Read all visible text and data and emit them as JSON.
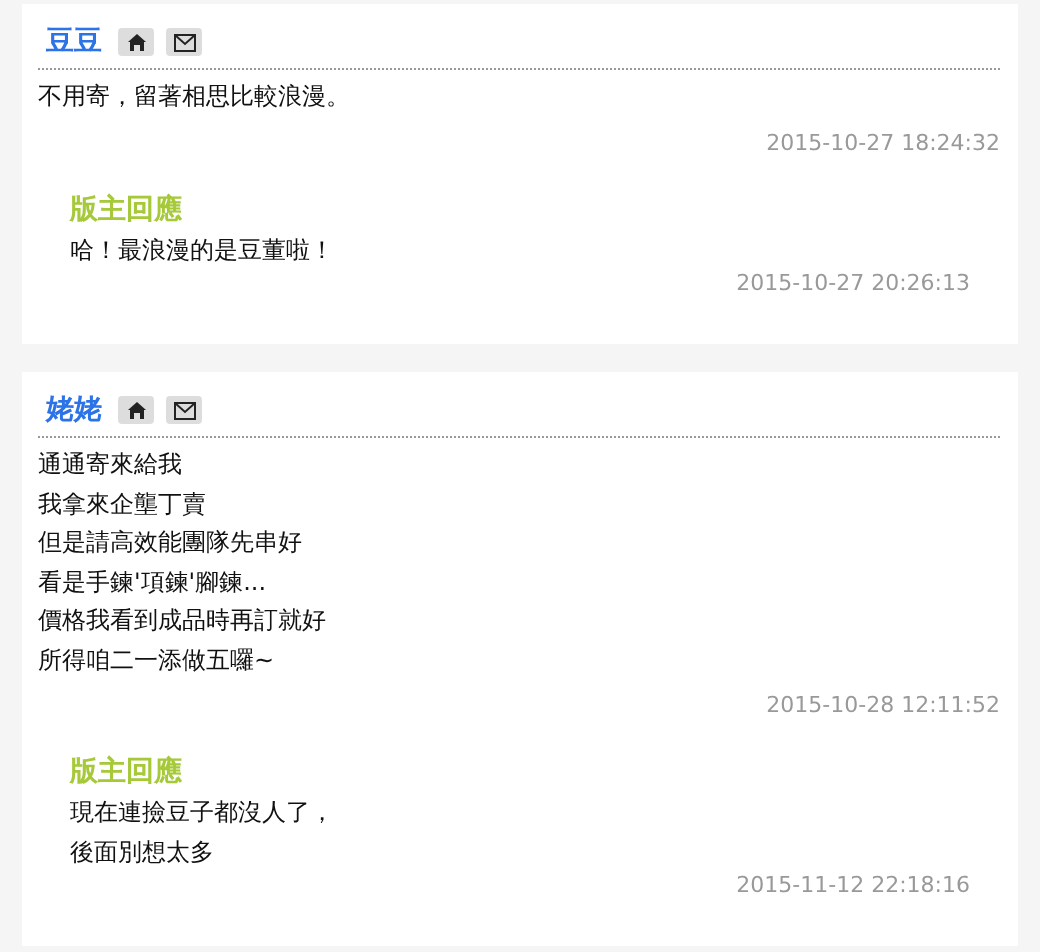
{
  "comments": [
    {
      "author": "豆豆",
      "lines": [
        "不用寄，留著相思比較浪漫。"
      ],
      "time": "2015-10-27 18:24:32",
      "reply": {
        "title": "版主回應",
        "lines": [
          "哈！最浪漫的是豆董啦！"
        ],
        "time": "2015-10-27 20:26:13"
      }
    },
    {
      "author": "姥姥",
      "lines": [
        "通通寄來給我",
        "我拿來企壟丁賣",
        "但是請高效能團隊先串好",
        "看是手鍊'項鍊'腳鍊...",
        "價格我看到成品時再訂就好",
        "所得咱二一添做五囉~"
      ],
      "time": "2015-10-28 12:11:52",
      "reply": {
        "title": "版主回應",
        "lines": [
          "現在連撿豆子都沒人了，",
          "後面別想太多"
        ],
        "time": "2015-11-12 22:18:16"
      }
    }
  ]
}
